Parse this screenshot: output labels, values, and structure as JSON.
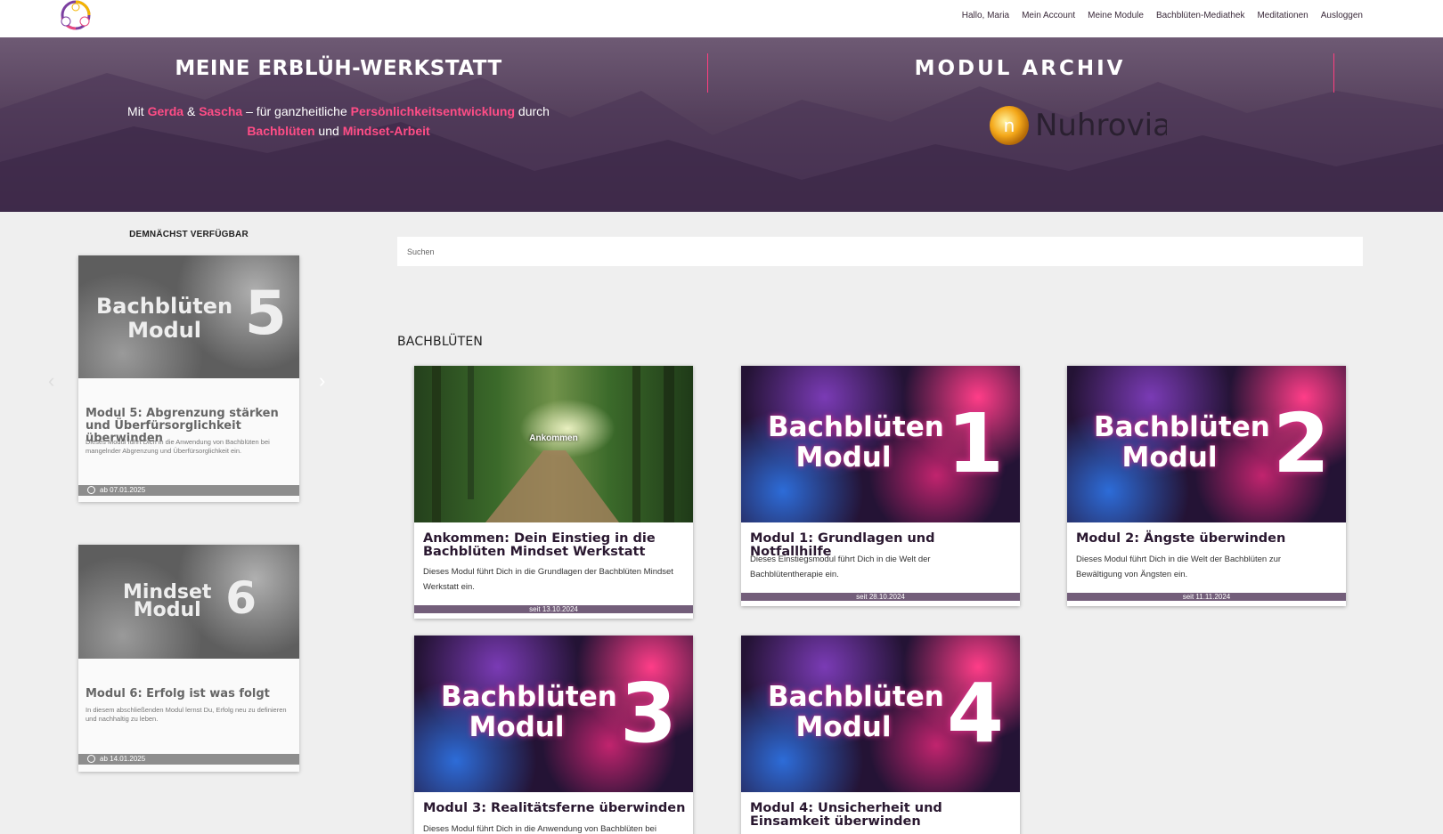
{
  "nav": {
    "greeting": "Hallo, Maria",
    "items": [
      "Mein Account",
      "Meine Module",
      "Bachblüten-Mediathek",
      "Meditationen",
      "Ausloggen"
    ]
  },
  "hero": {
    "title": "MEINE ERBLÜH-WERKSTATT",
    "sub": {
      "p1": "Mit ",
      "gerda": "Gerda",
      "amp": " & ",
      "sascha": "Sascha",
      "p2": " –  für ganzheitliche ",
      "pe": "Persönlichkeitsentwicklung",
      "p3": " durch",
      "bb": "Bachblüten",
      "und": " und ",
      "ma": "Mindset-Arbeit"
    },
    "archive_title": "MODUL ARCHIV",
    "brand_name": "Nuhrovia",
    "brand_letter": "n"
  },
  "sidebar": {
    "heading": "DEMNÄCHST VERFÜGBAR",
    "cards": [
      {
        "img_line1": "Bachblüten",
        "img_line2": "Modul",
        "img_num": "5",
        "title": "Modul 5: Abgrenzung stärken und Überfürsorglichkeit überwinden",
        "desc": "Dieses Modul führt Dich in die Anwendung von Bachblüten bei mangelnder Abgrenzung und Überfürsorglichkeit ein.",
        "date": "ab 07.01.2025"
      },
      {
        "img_line1": "Mindset",
        "img_line2": "Modul",
        "img_num": "6",
        "title": "Modul 6: Erfolg ist was folgt",
        "desc": "In diesem abschließenden Modul lernst Du, Erfolg neu zu definieren und nachhaltig zu leben.",
        "date": "ab 14.01.2025"
      }
    ]
  },
  "search": {
    "placeholder": "Suchen"
  },
  "section": {
    "heading": "BACHBLÜTEN"
  },
  "cards": [
    {
      "img_label": "Ankommen",
      "title": "Ankommen: Dein Einstieg in die Bachblüten Mindset Werkstatt",
      "desc": "Dieses Modul führt Dich in die Grundlagen der Bachblüten Mindset Werkstatt ein.",
      "date": "seit 13.10.2024"
    },
    {
      "img_line1": "Bachblüten",
      "img_line2": "Modul",
      "img_num": "1",
      "title": "Modul 1: Grundlagen und Notfallhilfe",
      "desc": "Dieses Einstiegsmodul führt Dich in die Welt der Bachblütentherapie ein.",
      "date": "seit 28.10.2024"
    },
    {
      "img_line1": "Bachblüten",
      "img_line2": "Modul",
      "img_num": "2",
      "title": "Modul 2: Ängste überwinden",
      "desc": "Dieses Modul führt Dich in die Welt der Bachblüten zur Bewältigung von Ängsten ein.",
      "date": "seit 11.11.2024"
    },
    {
      "img_line1": "Bachblüten",
      "img_line2": "Modul",
      "img_num": "3",
      "title": "Modul 3: Realitätsferne überwinden",
      "desc": "Dieses Modul führt Dich in die Anwendung von Bachblüten bei"
    },
    {
      "img_line1": "Bachblüten",
      "img_line2": "Modul",
      "img_num": "4",
      "title": "Modul 4: Unsicherheit und Einsamkeit überwinden"
    }
  ],
  "colors": {
    "accent": "#ff4d86",
    "hero_bg": "#55405c",
    "date_bar": "#735e7a"
  },
  "icons": {
    "prev": "chevron-left-icon",
    "next": "chevron-right-icon",
    "clock": "clock-icon"
  }
}
